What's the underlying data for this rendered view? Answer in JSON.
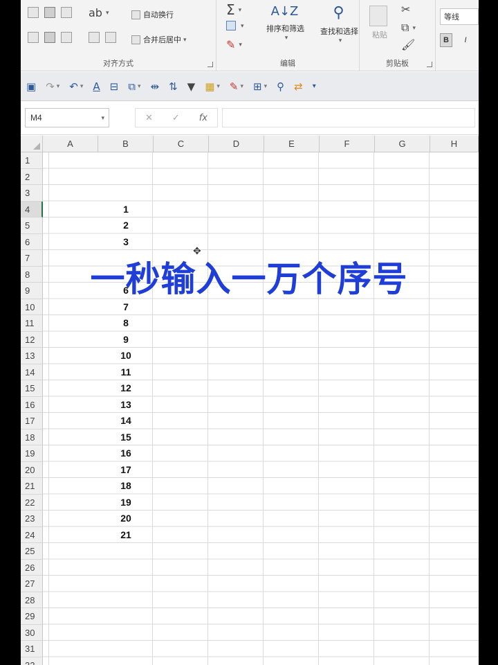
{
  "ribbon": {
    "alignment_group_label": "对齐方式",
    "wrap_text_label": "自动换行",
    "merge_center_label": "合并后居中",
    "editing_group_label": "编辑",
    "sort_filter_label": "排序和筛选",
    "find_select_label": "查找和选择",
    "clipboard_group_label": "剪贴板",
    "paste_label": "粘贴",
    "font_name": "等线",
    "bold_label": "B",
    "italic_label": "I"
  },
  "formula_bar": {
    "name_box": "M4",
    "cancel_symbol": "✕",
    "enter_symbol": "✓",
    "fx_symbol": "fx",
    "formula": ""
  },
  "columns": [
    "A",
    "B",
    "C",
    "D",
    "E",
    "F",
    "G",
    "H"
  ],
  "rows": [
    "1",
    "2",
    "3",
    "4",
    "5",
    "6",
    "7",
    "8",
    "9",
    "10",
    "11",
    "12",
    "13",
    "14",
    "15",
    "16",
    "17",
    "18",
    "19",
    "20",
    "21",
    "22",
    "23",
    "24",
    "25",
    "26",
    "27",
    "28",
    "29",
    "30",
    "31",
    "32"
  ],
  "active_row": "4",
  "column_b_values": [
    {
      "row": 4,
      "value": "1"
    },
    {
      "row": 5,
      "value": "2"
    },
    {
      "row": 6,
      "value": "3"
    },
    {
      "row": 9,
      "value": "6"
    },
    {
      "row": 10,
      "value": "7"
    },
    {
      "row": 11,
      "value": "8"
    },
    {
      "row": 12,
      "value": "9"
    },
    {
      "row": 13,
      "value": "10"
    },
    {
      "row": 14,
      "value": "11"
    },
    {
      "row": 15,
      "value": "12"
    },
    {
      "row": 16,
      "value": "13"
    },
    {
      "row": 17,
      "value": "14"
    },
    {
      "row": 18,
      "value": "15"
    },
    {
      "row": 19,
      "value": "16"
    },
    {
      "row": 20,
      "value": "17"
    },
    {
      "row": 21,
      "value": "18"
    },
    {
      "row": 22,
      "value": "19"
    },
    {
      "row": 23,
      "value": "20"
    },
    {
      "row": 24,
      "value": "21"
    }
  ],
  "overlay_caption": "一秒输入一万个序号",
  "colors": {
    "caption": "#1f3ed8",
    "qat_icons": "#2e5a9c",
    "header_bg": "#efefef",
    "gridline": "#dadada"
  }
}
